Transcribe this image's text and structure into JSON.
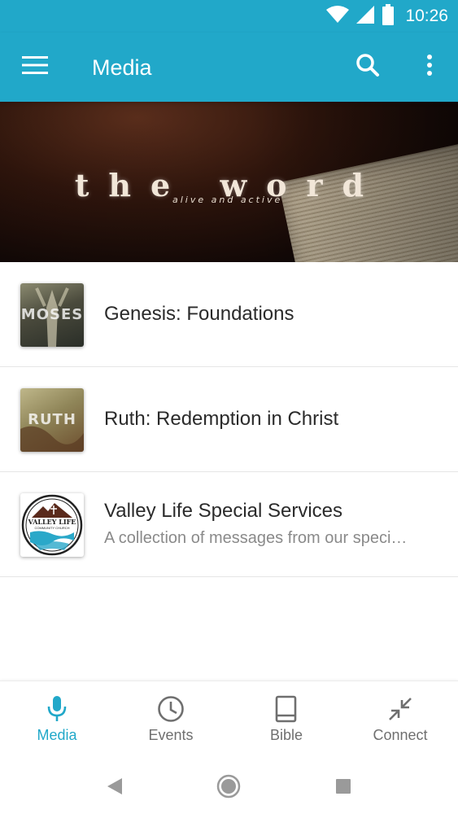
{
  "status_bar": {
    "time": "10:26",
    "icons": [
      "wifi-icon",
      "cell-signal-icon",
      "battery-icon"
    ]
  },
  "app_bar": {
    "title": "Media",
    "icons": [
      "menu-icon",
      "search-icon",
      "more-vert-icon"
    ]
  },
  "banner": {
    "title": "the word",
    "subtitle": "alive and active"
  },
  "list": {
    "items": [
      {
        "title": "Genesis: Foundations",
        "subtitle": "",
        "thumb_text": "MOSES"
      },
      {
        "title": "Ruth: Redemption in Christ",
        "subtitle": "",
        "thumb_text": "RUTH"
      },
      {
        "title": "Valley Life Special Services",
        "subtitle": "A collection of messages from our speci…",
        "thumb_text": "VALLEY LIFE",
        "thumb_subtext": "COMMUNITY CHURCH"
      }
    ]
  },
  "bottom_nav": {
    "items": [
      {
        "label": "Media",
        "icon": "microphone-icon",
        "active": true
      },
      {
        "label": "Events",
        "icon": "clock-icon",
        "active": false
      },
      {
        "label": "Bible",
        "icon": "book-icon",
        "active": false
      },
      {
        "label": "Connect",
        "icon": "compress-arrows-icon",
        "active": false
      }
    ]
  },
  "colors": {
    "accent": "#21a8c9",
    "inactive": "#6f6f6f",
    "title_text": "#2b2b2b",
    "subtitle_text": "#8a8a8a"
  }
}
